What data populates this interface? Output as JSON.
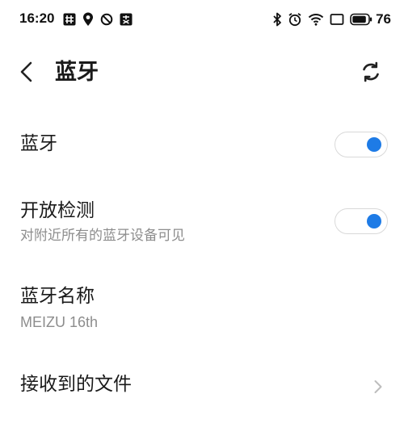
{
  "status_bar": {
    "time": "16:20",
    "battery_level": "76",
    "left_icons": [
      "grid-notification-icon",
      "du-location-icon",
      "do-not-disturb-icon",
      "app-notification-icon"
    ],
    "right_icons": [
      "bluetooth-icon",
      "alarm-icon",
      "wifi-icon",
      "screen-icon",
      "battery-icon"
    ]
  },
  "header": {
    "title": "蓝牙",
    "back_icon": "chevron-left-icon",
    "refresh_icon": "refresh-icon"
  },
  "settings": {
    "bluetooth": {
      "label": "蓝牙",
      "enabled": true
    },
    "discoverable": {
      "label": "开放检测",
      "description": "对附近所有的蓝牙设备可见",
      "enabled": true
    },
    "device_name": {
      "label": "蓝牙名称",
      "value": "MEIZU 16th"
    },
    "received_files": {
      "label": "接收到的文件",
      "icon": "chevron-right-icon"
    }
  },
  "colors": {
    "accent": "#1e7be6",
    "secondary_text": "#8d8d8d",
    "toggle_border": "#d9d9d9"
  }
}
